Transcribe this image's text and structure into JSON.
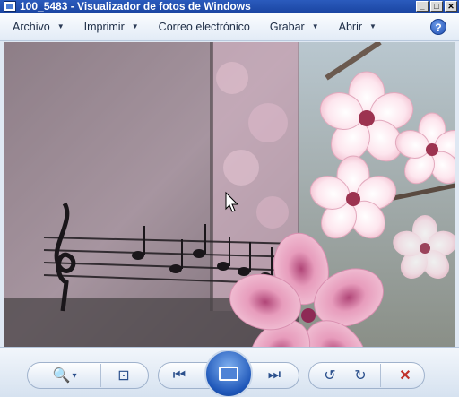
{
  "window": {
    "title": "100_5483 - Visualizador de fotos de Windows",
    "buttons": {
      "minimize": "_",
      "maximize": "□",
      "close": "✕"
    }
  },
  "menu": {
    "items": [
      {
        "label": "Archivo",
        "has_caret": true
      },
      {
        "label": "Imprimir",
        "has_caret": true
      },
      {
        "label": "Correo electrónico",
        "has_caret": false
      },
      {
        "label": "Grabar",
        "has_caret": true
      },
      {
        "label": "Abrir",
        "has_caret": true
      }
    ],
    "caret": "▼",
    "help": "?"
  },
  "photo": {
    "description_icons": [
      "music-notes",
      "cherry-blossoms",
      "hibiscus-flower"
    ]
  },
  "toolbar": {
    "zoom": "🔍",
    "zoom_caret": "▾",
    "fit": "⊡",
    "previous": "⏮",
    "next": "⏭",
    "rotate_left": "↺",
    "rotate_right": "↻",
    "delete": "✕",
    "colors": {
      "delete": "#c0312b",
      "accent": "#1e56b8"
    }
  }
}
